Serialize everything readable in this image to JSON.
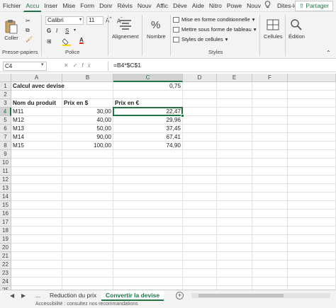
{
  "ribbon_tabs": [
    "Fichier",
    "Accu",
    "Inser",
    "Mise",
    "Form",
    "Donr",
    "Révis",
    "Nouv",
    "Affic",
    "Déve",
    "Aide",
    "Nitro",
    "Powe",
    "Nouv"
  ],
  "active_tab_index": 1,
  "tell_me": "Dites-le-",
  "share_label": "Partager",
  "clipboard": {
    "paste_label": "Coller",
    "group_label": "Presse-papiers"
  },
  "font": {
    "name": "Calibri",
    "size": "11",
    "bold": "G",
    "italic": "I",
    "underline": "S",
    "group_label": "Police"
  },
  "alignment": {
    "label": "Alignement"
  },
  "number": {
    "label": "Nombre"
  },
  "styles": {
    "items": [
      "Mise en forme conditionnelle",
      "Mettre sous forme de tableau",
      "Styles de cellules"
    ],
    "group_label": "Styles"
  },
  "cells_label": "Cellules",
  "editing_label": "Édition",
  "formula_bar": {
    "name_box": "C4",
    "formula": "=B4*$C$1",
    "fx": "fx"
  },
  "columns": [
    "A",
    "B",
    "C",
    "D",
    "E",
    "F"
  ],
  "rows": [
    "1",
    "2",
    "3",
    "4",
    "5",
    "6",
    "7",
    "8",
    "9",
    "10",
    "11",
    "12",
    "13",
    "14",
    "15",
    "16",
    "17",
    "18",
    "19",
    "20",
    "21",
    "22",
    "23",
    "24",
    "25"
  ],
  "selected_row": "4",
  "selected_col": "C",
  "cells": {
    "A1": "Calcul avec devise",
    "C1": "0,75",
    "A3": "Nom du produit",
    "B3": "Prix en $",
    "C3": "Prix en €",
    "A4": "M11",
    "B4": "30,00",
    "C4": "22,47",
    "A5": "M12",
    "B5": "40,00",
    "C5": "29,96",
    "A6": "M13",
    "B6": "50,00",
    "C6": "37,45",
    "A7": "M14",
    "B7": "90,00",
    "C7": "67,41",
    "A8": "M15",
    "B8": "100,00",
    "C8": "74,90"
  },
  "sheets": [
    "...",
    "Reduction du prix",
    "Convertir la devise"
  ],
  "active_sheet_index": 2,
  "status_text": "Accessibilité : consultez nos recommandations",
  "colors": {
    "accent": "#217346"
  }
}
